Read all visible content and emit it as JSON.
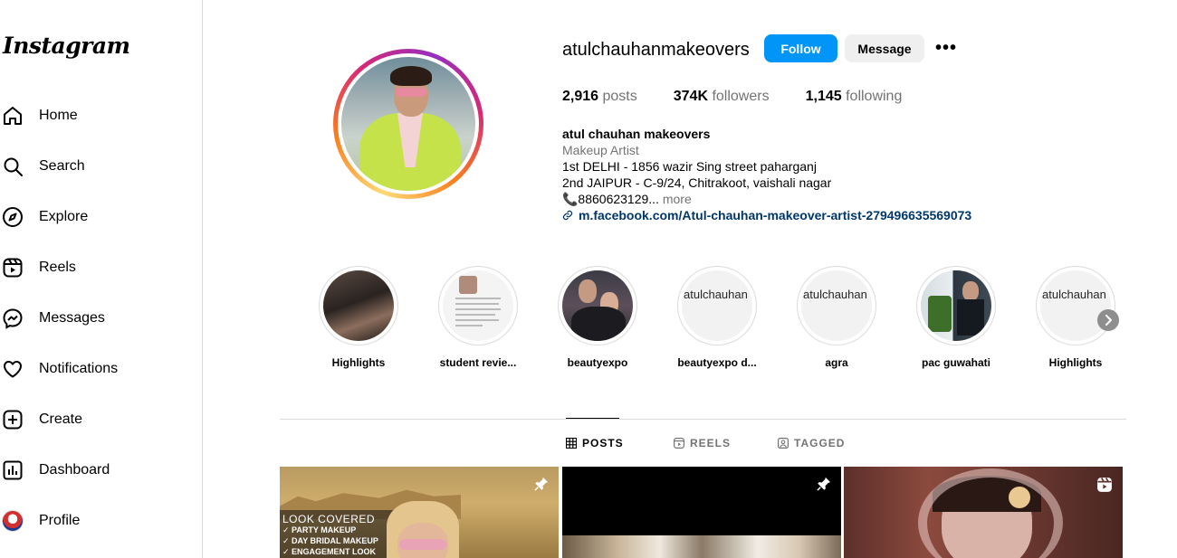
{
  "sidebar": {
    "logo": "Instagram",
    "items": [
      {
        "label": "Home",
        "icon": "home-icon"
      },
      {
        "label": "Search",
        "icon": "search-icon"
      },
      {
        "label": "Explore",
        "icon": "compass-icon"
      },
      {
        "label": "Reels",
        "icon": "reels-icon"
      },
      {
        "label": "Messages",
        "icon": "messenger-icon"
      },
      {
        "label": "Notifications",
        "icon": "heart-icon"
      },
      {
        "label": "Create",
        "icon": "plus-square-icon"
      },
      {
        "label": "Dashboard",
        "icon": "dashboard-icon"
      },
      {
        "label": "Profile",
        "icon": "avatar"
      }
    ]
  },
  "profile": {
    "username": "atulchauhanmakeovers",
    "follow_label": "Follow",
    "message_label": "Message",
    "more_label": "•••",
    "stats": {
      "posts_count": "2,916",
      "posts_label": "posts",
      "followers_count": "374K",
      "followers_label": "followers",
      "following_count": "1,145",
      "following_label": "following"
    },
    "bio": {
      "name": "atul chauhan makeovers",
      "category": "Makeup Artist",
      "line1": "1st DELHI - 1856 wazir Sing street paharganj",
      "line2": "2nd JAIPUR - C-9/24, Chitrakoot, vaishali nagar",
      "phone": "📞8860623129...",
      "more": "more",
      "link": "m.facebook.com/Atul-chauhan-makeover-artist-279496635569073"
    }
  },
  "highlights": [
    {
      "label": "Highlights",
      "alt": ""
    },
    {
      "label": "student revie...",
      "alt": ""
    },
    {
      "label": "beautyexpo",
      "alt": ""
    },
    {
      "label": "beautyexpo d...",
      "alt": "atulchauhan highlight sto"
    },
    {
      "label": "agra",
      "alt": "atulchauhan highlight sto"
    },
    {
      "label": "pac guwahati",
      "alt": ""
    },
    {
      "label": "Highlights",
      "alt": "atulchauhan highlight sto"
    }
  ],
  "tabs": [
    {
      "label": "POSTS",
      "icon": "grid-icon",
      "active": true
    },
    {
      "label": "REELS",
      "icon": "reels-icon",
      "active": false
    },
    {
      "label": "TAGGED",
      "icon": "tagged-icon",
      "active": false
    }
  ],
  "posts": [
    {
      "overlay_lines": [
        "LOOK COVERED",
        "✓ PARTY MAKEUP",
        "✓ DAY BRIDAL MAKEUP",
        "✓ ENGAGEMENT LOOK"
      ],
      "badge": "pin-icon"
    },
    {
      "overlay_lines": [],
      "badge": "pin-icon"
    },
    {
      "overlay_lines": [],
      "badge": "reel-badge-icon"
    }
  ],
  "colors": {
    "primary": "#0095f6",
    "secondary_btn": "#efefef",
    "muted": "#737373",
    "link": "#00376b",
    "border": "#dbdbdb"
  }
}
